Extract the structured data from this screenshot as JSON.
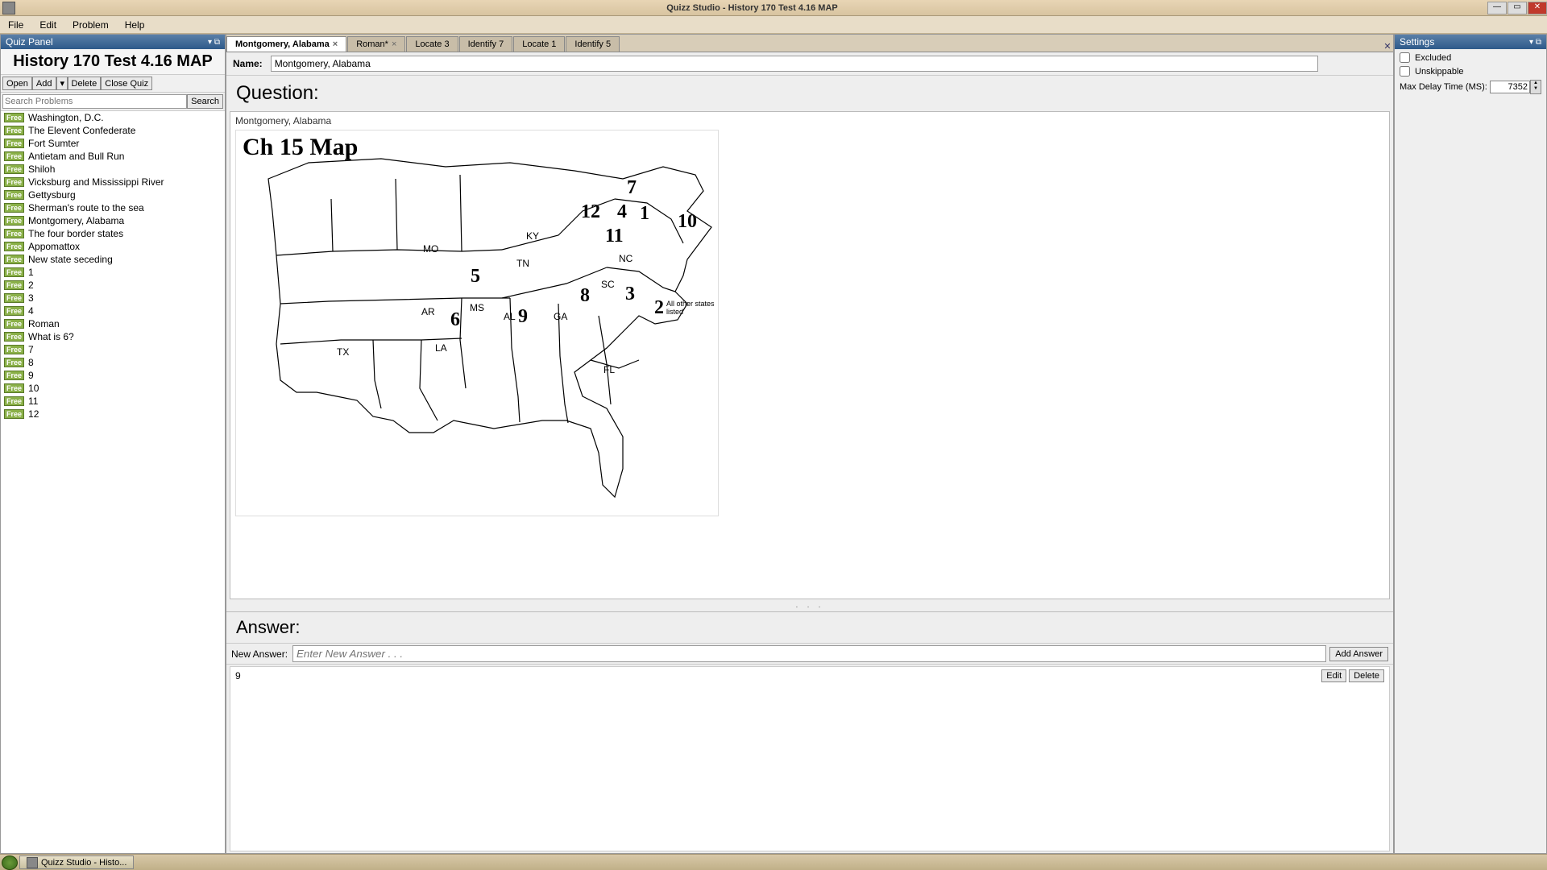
{
  "window": {
    "title": "Quizz Studio  - History 170 Test 4.16 MAP",
    "min": "—",
    "max": "▭",
    "close": "✕"
  },
  "menu": {
    "file": "File",
    "edit": "Edit",
    "problem": "Problem",
    "help": "Help"
  },
  "quiz_panel": {
    "header": "Quiz Panel",
    "title": "History 170 Test 4.16 MAP",
    "btn_open": "Open",
    "btn_add": "Add",
    "btn_delete": "Delete",
    "btn_close": "Close Quiz",
    "search_placeholder": "Search Problems",
    "btn_search": "Search",
    "badge": "Free",
    "items": [
      "Washington, D.C.",
      "The Elevent Confederate",
      "Fort Sumter",
      "Antietam and Bull Run",
      "Shiloh",
      "Vicksburg and Mississippi River",
      "Gettysburg",
      "Sherman's route to the sea",
      "Montgomery, Alabama",
      "The four border states",
      "Appomattox",
      "New state seceding",
      "1",
      "2",
      "3",
      "4",
      "Roman",
      "What is 6?",
      "7",
      "8",
      "9",
      "10",
      "11",
      "12"
    ]
  },
  "tabs": [
    {
      "label": "Montgomery, Alabama",
      "active": true,
      "closable": true
    },
    {
      "label": "Roman*",
      "active": false,
      "closable": true
    },
    {
      "label": "Locate 3",
      "active": false,
      "closable": false
    },
    {
      "label": "Identify 7",
      "active": false,
      "closable": false
    },
    {
      "label": "Locate 1",
      "active": false,
      "closable": false
    },
    {
      "label": "Identify 5",
      "active": false,
      "closable": false
    }
  ],
  "editor": {
    "name_label": "Name:",
    "name_value": "Montgomery, Alabama",
    "question_header": "Question:",
    "question_text": "Montgomery, Alabama",
    "map_title": "Ch 15 Map",
    "map_numbers": {
      "n1": "1",
      "n2": "2",
      "n3": "3",
      "n4": "4",
      "n5": "5",
      "n6": "6",
      "n7": "7",
      "n8": "8",
      "n9": "9",
      "n10": "10",
      "n11": "11",
      "n12": "12"
    },
    "map_state_labels": {
      "MO": "MO",
      "KY": "KY",
      "TN": "TN",
      "AR": "AR",
      "MS": "MS",
      "AL": "AL",
      "GA": "GA",
      "SC": "SC",
      "NC": "NC",
      "LA": "LA",
      "TX": "TX",
      "FL": "FL"
    },
    "map_note": "All other states listed",
    "answer_header": "Answer:",
    "new_answer_label": "New Answer:",
    "new_answer_placeholder": "Enter New Answer . . .",
    "btn_add_answer": "Add Answer",
    "answers": [
      {
        "value": "9"
      }
    ],
    "btn_edit": "Edit",
    "btn_delete": "Delete"
  },
  "settings": {
    "header": "Settings",
    "excluded": "Excluded",
    "unskippable": "Unskippable",
    "max_delay_label": "Max Delay Time (MS):",
    "max_delay_value": "7352"
  },
  "taskbar": {
    "item": "Quizz Studio  - Histo..."
  }
}
